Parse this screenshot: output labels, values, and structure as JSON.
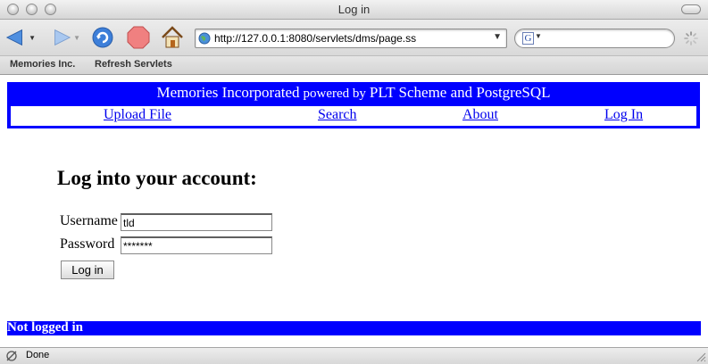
{
  "window": {
    "title": "Log in"
  },
  "toolbar": {
    "url": "http://127.0.0.1:8080/servlets/dms/page.ss",
    "search_engine_letter": "G",
    "icons": [
      "back-arrow-icon",
      "forward-arrow-icon",
      "reload-icon",
      "stop-icon",
      "home-icon",
      "globe-icon",
      "loading-spinner-icon"
    ]
  },
  "bookmarks": {
    "items": [
      "Memories Inc.",
      "Refresh Servlets"
    ]
  },
  "header": {
    "title_main": "Memories Incorporated",
    "title_powered": "powered by",
    "title_tech": "PLT Scheme and PostgreSQL",
    "nav": [
      "Upload File",
      "Search",
      "About",
      "Log In"
    ],
    "background_color": "#0000ff",
    "link_color": "#0000ee"
  },
  "login_form": {
    "heading": "Log into your account:",
    "username_label": "Username",
    "username_value": "tld",
    "password_label": "Password",
    "password_value": "*******",
    "submit_label": "Log in"
  },
  "footer": {
    "status": "Not logged in"
  },
  "browser_status": {
    "text": "Done"
  }
}
